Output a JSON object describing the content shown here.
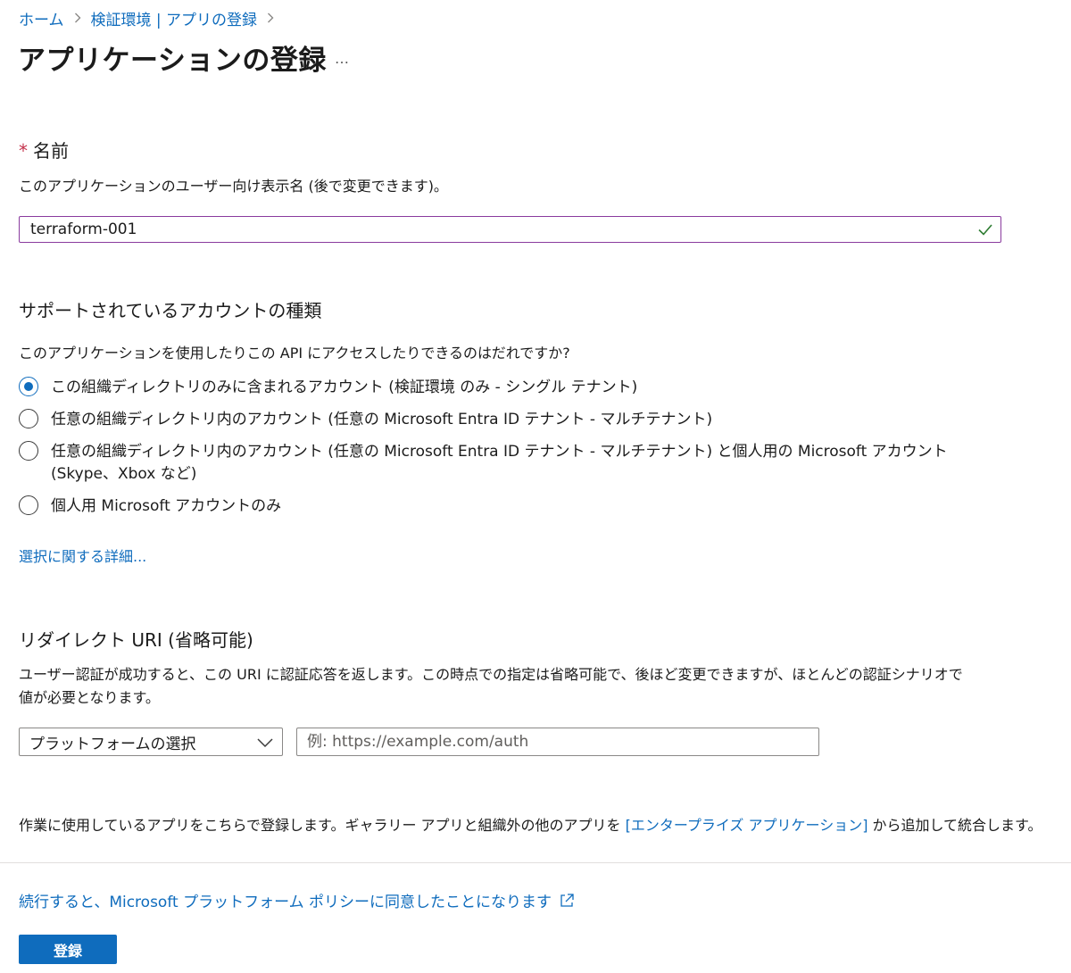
{
  "breadcrumb": {
    "items": [
      "ホーム",
      "検証環境 | アプリの登録"
    ]
  },
  "page": {
    "title": "アプリケーションの登録",
    "more": "…"
  },
  "name_section": {
    "required_mark": "*",
    "label": "名前",
    "description": "このアプリケーションのユーザー向け表示名 (後で変更できます)。",
    "input_value": "terraform-001",
    "valid_icon": "checkmark-icon"
  },
  "account_types": {
    "heading": "サポートされているアカウントの種類",
    "question": "このアプリケーションを使用したりこの API にアクセスしたりできるのはだれですか?",
    "options": [
      {
        "label": "この組織ディレクトリのみに含まれるアカウント (検証環境 のみ - シングル テナント)",
        "selected": true
      },
      {
        "label": "任意の組織ディレクトリ内のアカウント (任意の Microsoft Entra ID テナント - マルチテナント)",
        "selected": false
      },
      {
        "label": "任意の組織ディレクトリ内のアカウント (任意の Microsoft Entra ID テナント - マルチテナント) と個人用の Microsoft アカウント (Skype、Xbox など)",
        "selected": false
      },
      {
        "label": "個人用 Microsoft アカウントのみ",
        "selected": false
      }
    ],
    "details_link": "選択に関する詳細..."
  },
  "redirect_uri": {
    "heading": "リダイレクト URI (省略可能)",
    "description_line1": "ユーザー認証が成功すると、この URI に認証応答を返します。この時点での指定は省略可能で、後ほど変更できますが、ほとんどの認証シナリオで",
    "description_line2": "値が必要となります。",
    "platform_select": "プラットフォームの選択",
    "uri_placeholder": "例: https://example.com/auth"
  },
  "footer_note": {
    "before_link": "作業に使用しているアプリをこちらで登録します。ギャラリー アプリと組織外の他のアプリを ",
    "link": "[エンタープライズ アプリケーション]",
    "after_link": " から追加して統合します。"
  },
  "policy": {
    "link": "続行すると、Microsoft プラットフォーム ポリシーに同意したことになります",
    "icon": "external-link-icon"
  },
  "actions": {
    "register_label": "登録"
  },
  "colors": {
    "accent": "#0f6cbd",
    "required": "#c4314b",
    "input_focus_border": "#8a3b9e",
    "valid": "#2e7d32"
  }
}
